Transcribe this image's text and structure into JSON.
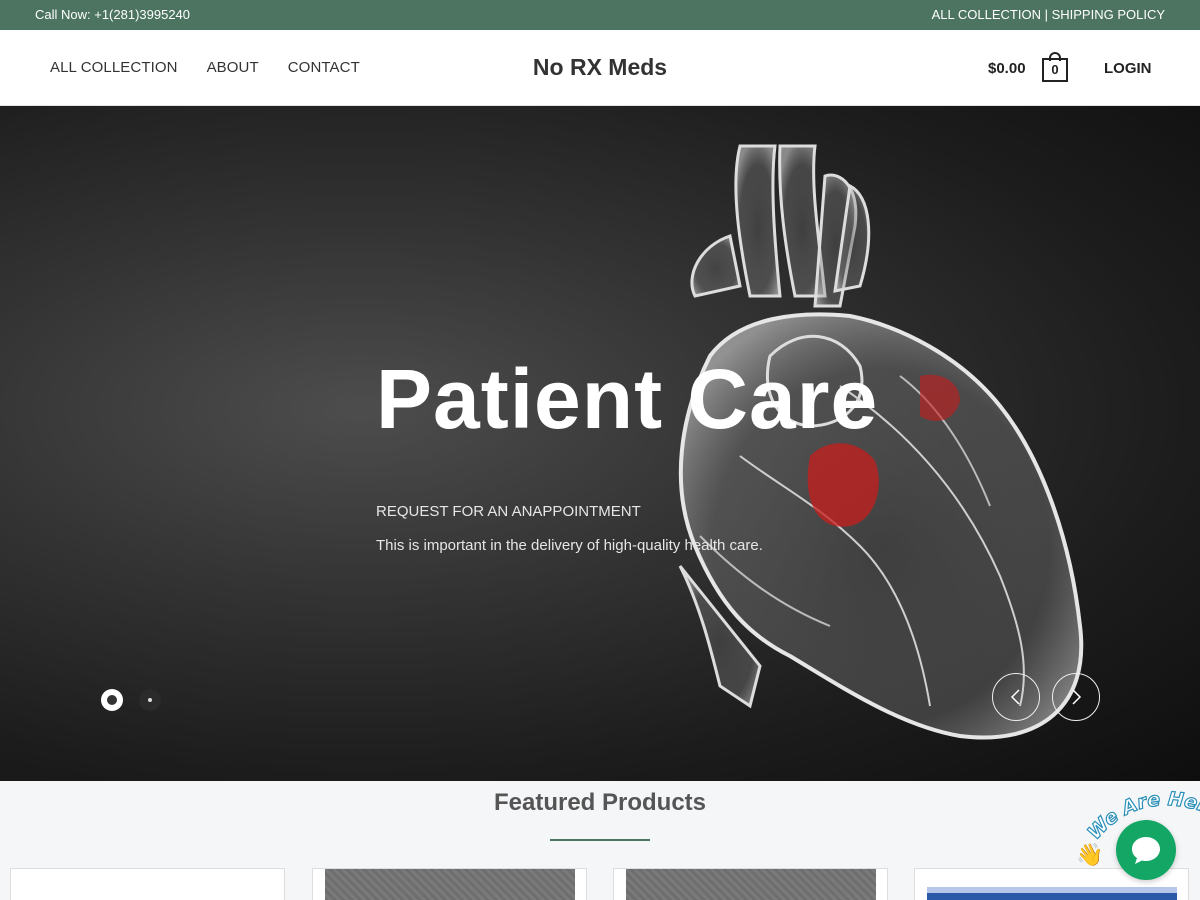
{
  "topbar": {
    "call": "Call Now: +1(281)3995240",
    "link_collection": "ALL COLLECTION",
    "separator": " | ",
    "link_shipping": "SHIPPING POLICY"
  },
  "nav": {
    "items": [
      {
        "label": "ALL COLLECTION"
      },
      {
        "label": "ABOUT"
      },
      {
        "label": "CONTACT"
      }
    ]
  },
  "brand": {
    "name": "No RX Meds"
  },
  "cart": {
    "total": "$0.00",
    "count": "0"
  },
  "account": {
    "login_label": "LOGIN"
  },
  "hero": {
    "title": "Patient Care",
    "subtitle": "REQUEST FOR AN ANAPPOINTMENT",
    "description": "This is important in the delivery of high-quality health care."
  },
  "featured": {
    "title": "Featured Products"
  },
  "chat": {
    "badge_text": "We Are Here!",
    "wave_emoji": "👋"
  },
  "colors": {
    "accent": "#4c7461",
    "chat": "#13a665"
  }
}
